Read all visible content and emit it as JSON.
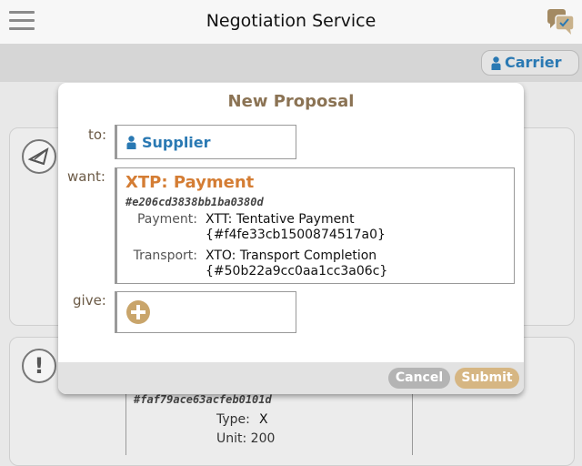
{
  "app": {
    "title": "Negotiation Service"
  },
  "icons": {
    "menu": "hamburger-menu-icon",
    "chat": "chat-bubbles-icon",
    "person": "person-icon",
    "envelope": "envelope-icon",
    "alert": "exclamation-icon",
    "add": "add-circle-icon"
  },
  "role_button": {
    "label": "Carrier"
  },
  "background": {
    "alert_symbol": "!",
    "hash": "#faf79ace63acfeb0101d",
    "type_label": "Type:",
    "type_value": "X",
    "unit_label": "Unit: 200"
  },
  "dialog": {
    "title": "New Proposal",
    "to_label": "to:",
    "to_value": "Supplier",
    "want_label": "want:",
    "want": {
      "title": "XTP: Payment",
      "hash": "#e206cd3838bb1ba0380d",
      "terms": [
        {
          "label": "Payment:",
          "line1": "XTT: Tentative Payment",
          "line2": "{#f4fe33cb1500874517a0}"
        },
        {
          "label": "Transport:",
          "line1": "XTO: Transport Completion",
          "line2": "{#50b22a9cc0aa1cc3a06c}"
        }
      ]
    },
    "give_label": "give:",
    "cancel_label": "Cancel",
    "submit_label": "Submit"
  },
  "colors": {
    "accent_brown": "#8b7354",
    "orange": "#d47d34",
    "blue": "#2a79b3",
    "submit": "#d6b683",
    "cancel": "#b4b4b4"
  }
}
